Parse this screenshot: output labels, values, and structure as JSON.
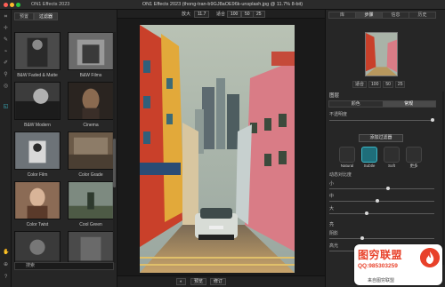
{
  "app": {
    "name": "ON1 Effects 2023",
    "window_title": "ON1 Effects 2023 (thong-tran-b9GJ8aOE96k-unsplash.jpg @ 11.7% 8-bit)"
  },
  "browser": {
    "tabs": [
      "预置",
      "过滤器"
    ],
    "active_tab": 1,
    "items": [
      {
        "label": "B&W Faded & Matte",
        "color": "#4a4a4a"
      },
      {
        "label": "B&W Films",
        "color": "#6b6b6b"
      },
      {
        "label": "B&W Modern",
        "color": "#3c3c3c"
      },
      {
        "label": "Cinema",
        "color": "#5a4a3a"
      },
      {
        "label": "Color Film",
        "color": "#6d7378"
      },
      {
        "label": "Color Grade",
        "color": "#6b5a48"
      },
      {
        "label": "Color Twist",
        "color": "#8b6b55"
      },
      {
        "label": "Cool Green",
        "color": "#4d5a45"
      },
      {
        "label": "",
        "color": "#3a3a3a"
      },
      {
        "label": "",
        "color": "#4a4a4a"
      }
    ],
    "search_placeholder": "搜索"
  },
  "zoombar": {
    "zoom_label": "放大",
    "zoom_value": "11.7",
    "fit_label": "适合",
    "z100": "100",
    "z50": "50",
    "z25": "25"
  },
  "bottombar": {
    "preview_label": "预览",
    "modify_label": "修订"
  },
  "panel": {
    "tabs": [
      "库",
      "步骤",
      "信息",
      "历史"
    ],
    "active_tab": 1,
    "nav_zoom": [
      "适合",
      "100",
      "50",
      "25"
    ],
    "layers_title": "图层",
    "blend_seg": [
      "颜色",
      "常规"
    ],
    "blend_active": 1,
    "opacity_label": "不透明度",
    "add_filter_label": "添加过滤器",
    "modes": [
      "Natural",
      "Subtle",
      "Soft",
      "更多"
    ],
    "active_mode": 1,
    "dynamic_title": "动态对比度",
    "sliders1": [
      "小",
      "中",
      "大"
    ],
    "slider1_values": [
      0.55,
      0.45,
      0.35
    ],
    "highlight_title": "亮",
    "sliders2": [
      "阴影",
      "高光"
    ],
    "slider2_values": [
      0.3,
      0.35
    ]
  },
  "watermark": {
    "title": "图穷联盟",
    "qq": "QQ:985303259",
    "sub": "来自图穷联盟"
  },
  "colors": {
    "accent": "#3cb6c6",
    "panel_bg": "#262626",
    "watermark_red": "#e8412a"
  }
}
